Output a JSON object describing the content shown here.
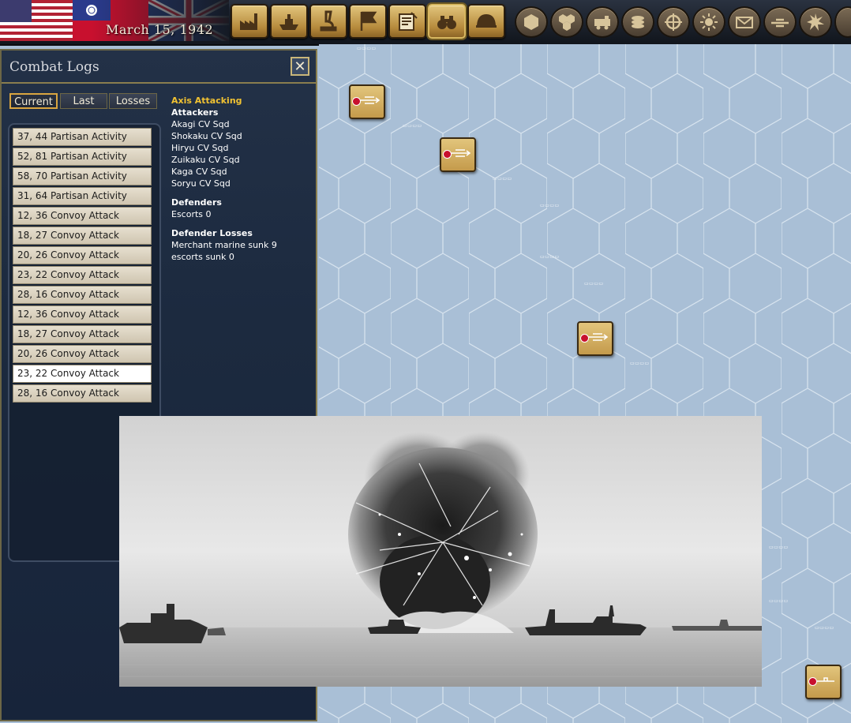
{
  "header": {
    "date": "March 15, 1942"
  },
  "toolbar": {
    "buttons": [
      {
        "name": "production",
        "icon": "factory-icon"
      },
      {
        "name": "naval",
        "icon": "ship-icon"
      },
      {
        "name": "research",
        "icon": "microscope-icon"
      },
      {
        "name": "objectives",
        "icon": "flag-icon"
      },
      {
        "name": "reports",
        "icon": "notepad-icon"
      },
      {
        "name": "intelligence",
        "icon": "binoculars-icon",
        "active": true
      },
      {
        "name": "army",
        "icon": "helmet-icon"
      }
    ],
    "round_buttons": [
      "hex-icon",
      "hexes-icon",
      "train-icon",
      "coins-icon",
      "crosshair-icon",
      "sun-icon",
      "envelope-icon",
      "plane-icon",
      "explosion-icon"
    ]
  },
  "panel": {
    "title": "Combat Logs",
    "tabs": [
      {
        "label": "Current",
        "active": true
      },
      {
        "label": "Last",
        "active": false
      },
      {
        "label": "Losses",
        "active": false
      }
    ],
    "logs": [
      "37, 44 Partisan Activity",
      "52, 81 Partisan Activity",
      "58, 70 Partisan Activity",
      "31, 64 Partisan Activity",
      "12, 36 Convoy Attack",
      "18, 27 Convoy Attack",
      "20, 26 Convoy Attack",
      "23, 22 Convoy Attack",
      "28, 16 Convoy Attack",
      "12, 36 Convoy Attack",
      "18, 27 Convoy Attack",
      "20, 26 Convoy Attack",
      "23, 22 Convoy Attack",
      "28, 16 Convoy Attack"
    ],
    "selected_index": 12,
    "detail": {
      "side": "Axis Attacking",
      "attackers_heading": "Attackers",
      "attackers": [
        "Akagi CV Sqd",
        "Shokaku CV Sqd",
        "Hiryu CV Sqd",
        "Zuikaku CV Sqd",
        "Kaga CV Sqd",
        "Soryu CV Sqd"
      ],
      "defenders_heading": "Defenders",
      "defenders": [
        "Escorts 0"
      ],
      "losses_heading": "Defender Losses",
      "losses": [
        "Merchant marine sunk 9",
        "escorts sunk 0"
      ]
    }
  },
  "colors": {
    "sea": "#a9bfd6",
    "panel": "#1c2a3f",
    "highlight": "#f1c232",
    "unit_tan": "#d4b065"
  }
}
